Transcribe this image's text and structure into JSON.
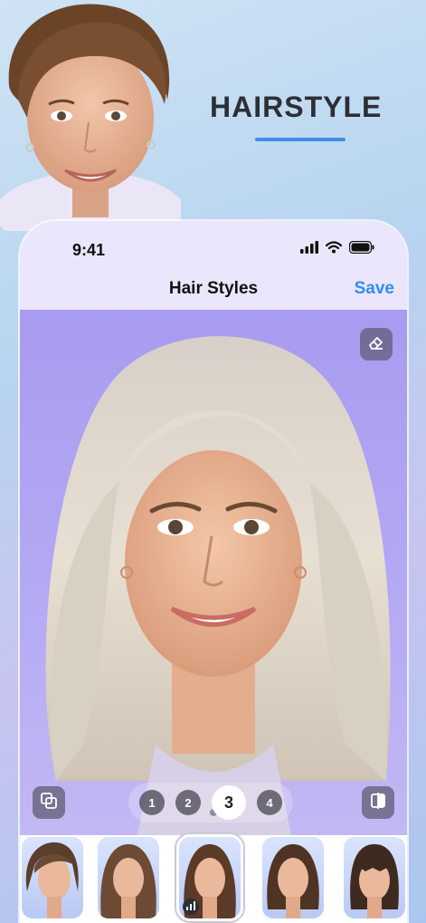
{
  "promo": {
    "title": "HAIRSTYLE"
  },
  "status_bar": {
    "time": "9:41"
  },
  "nav": {
    "title": "Hair Styles",
    "save_label": "Save"
  },
  "steps": {
    "items": [
      "1",
      "2",
      "3",
      "4"
    ],
    "selected": "3"
  },
  "thumbnails": {
    "count": 5,
    "selected_index": 2
  },
  "colors": {
    "accent": "#2f8ff0",
    "title_text": "#2c2f36",
    "underline": "#3e8ee6",
    "nav_background": "#ebe6fb"
  },
  "icons": {
    "eraser": "eraser-icon",
    "layers": "layers-icon",
    "compare": "compare-icon",
    "signal": "signal-icon",
    "wifi": "wifi-icon",
    "battery": "battery-icon"
  }
}
